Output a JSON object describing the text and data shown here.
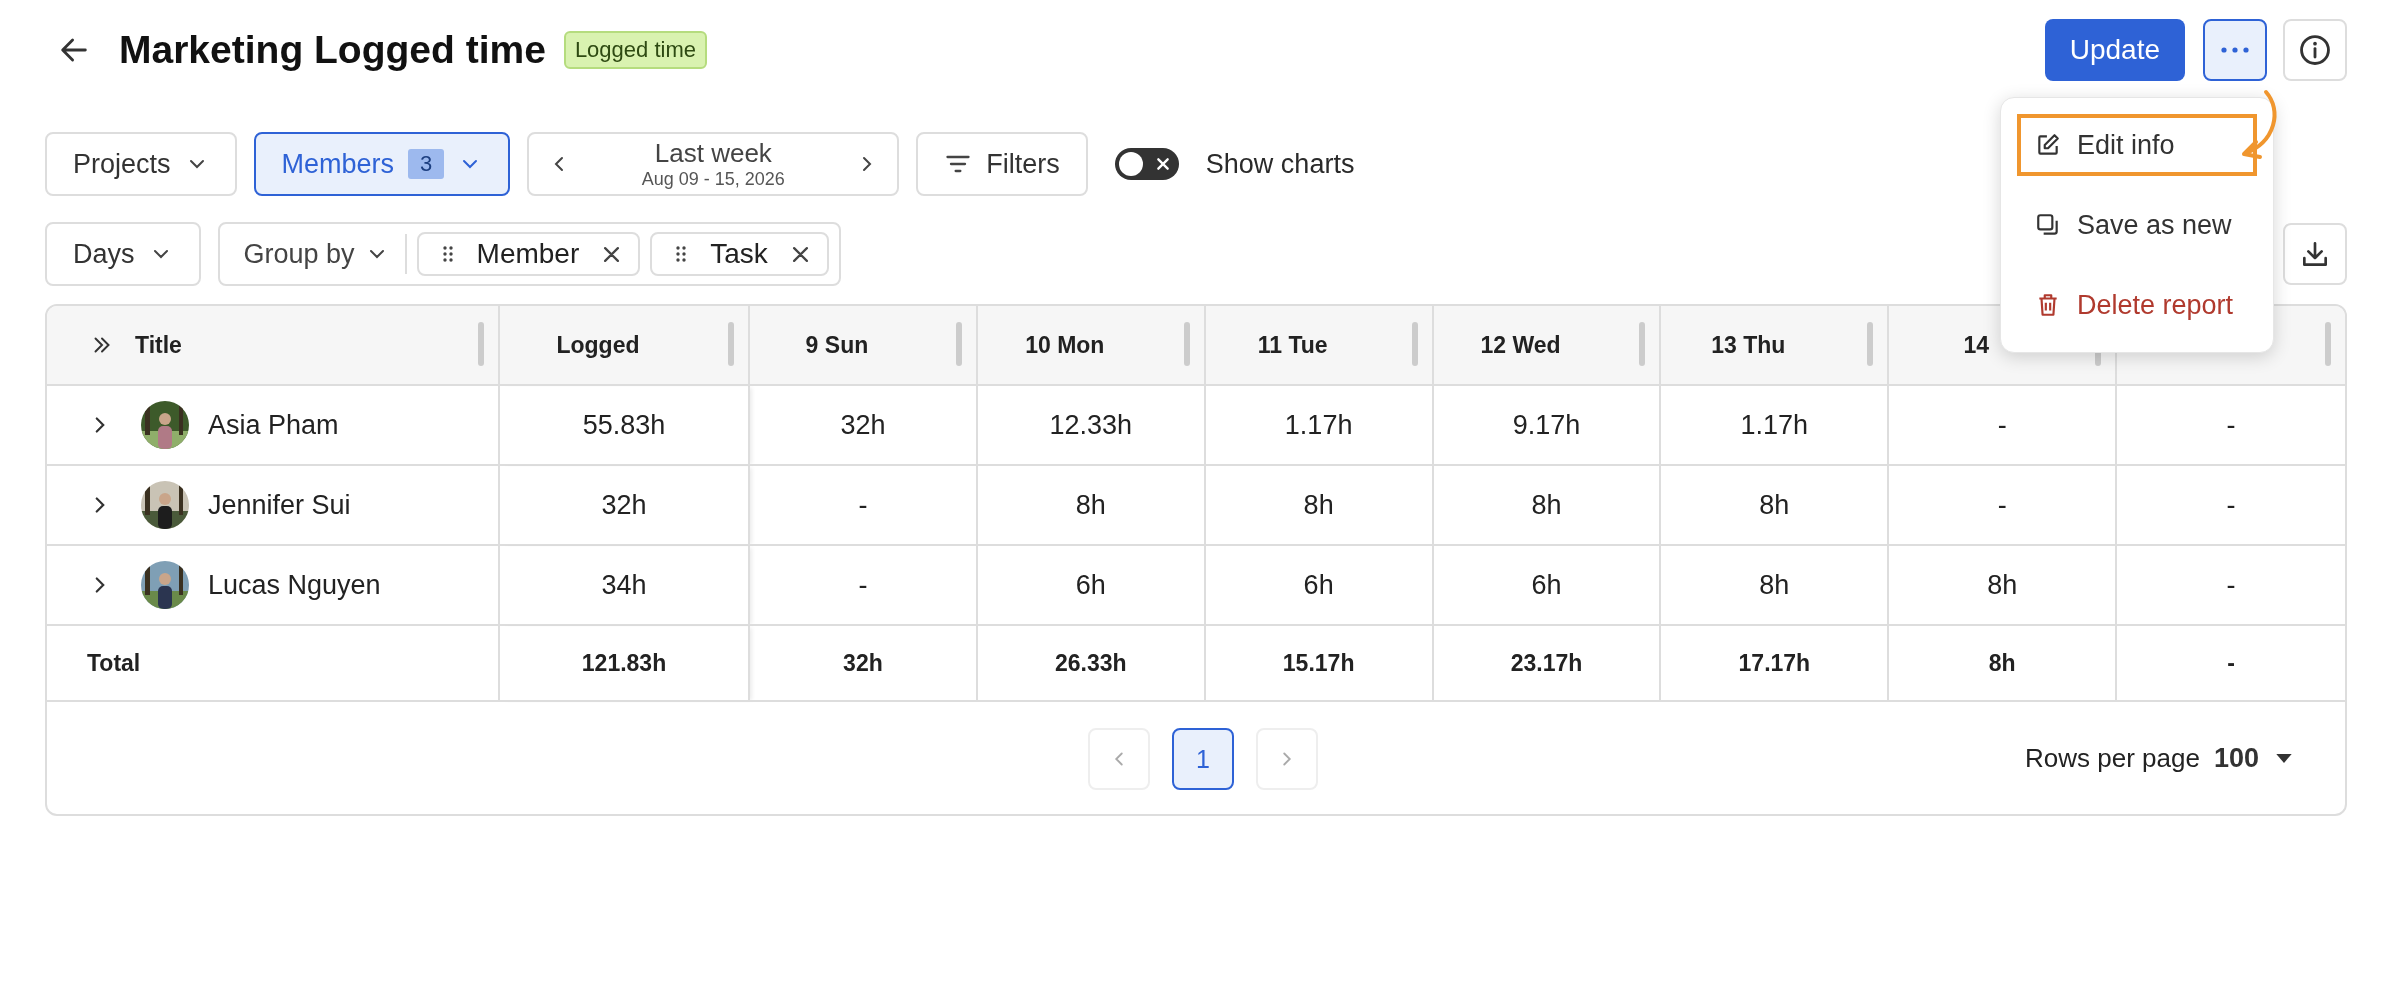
{
  "header": {
    "title": "Marketing Logged time",
    "tag": "Logged time",
    "update_button": "Update",
    "more_menu_open": true
  },
  "menu": [
    {
      "kind": "edit",
      "label": "Edit info",
      "highlighted": true
    },
    {
      "kind": "copy",
      "label": "Save as new",
      "highlighted": false
    },
    {
      "kind": "delete",
      "label": "Delete report",
      "highlighted": false
    }
  ],
  "filters": [
    {
      "label": "Projects",
      "selected": false
    },
    {
      "label": "Members",
      "selected": true,
      "count": "3"
    }
  ],
  "date_range": {
    "label": "Last week",
    "dates": "Aug 09 - 15, 2026"
  },
  "filters_button": "Filters",
  "show_charts": {
    "label": "Show charts",
    "on": false
  },
  "period": "Days",
  "group_by": {
    "label": "Group by",
    "chips": [
      "Member",
      "Task"
    ]
  },
  "table": {
    "columns": [
      "Title",
      "Logged",
      "9 Sun",
      "10 Mon",
      "11 Tue",
      "12 Wed",
      "13 Thu",
      "14"
    ],
    "rows": [
      {
        "expanded": false,
        "cells": [
          "Asia Pham",
          "55.83h",
          "32h",
          "12.33h",
          "1.17h",
          "9.17h",
          "1.17h",
          "-",
          "-"
        ]
      },
      {
        "expanded": false,
        "cells": [
          "Jennifer Sui",
          "32h",
          "-",
          "8h",
          "8h",
          "8h",
          "8h",
          "-",
          "-"
        ]
      },
      {
        "expanded": false,
        "cells": [
          "Lucas Nguyen",
          "34h",
          "-",
          "6h",
          "6h",
          "6h",
          "8h",
          "8h",
          "-"
        ]
      }
    ],
    "total": {
      "cells": [
        "Total",
        "121.83h",
        "32h",
        "26.33h",
        "15.17h",
        "23.17h",
        "17.17h",
        "8h",
        "-"
      ]
    }
  },
  "pagination": {
    "prev_disabled": true,
    "next_disabled": true,
    "pages": [
      {
        "label": "1",
        "selected": true
      }
    ],
    "rows_per_page_label": "Rows per page",
    "rows_per_page": "100"
  }
}
